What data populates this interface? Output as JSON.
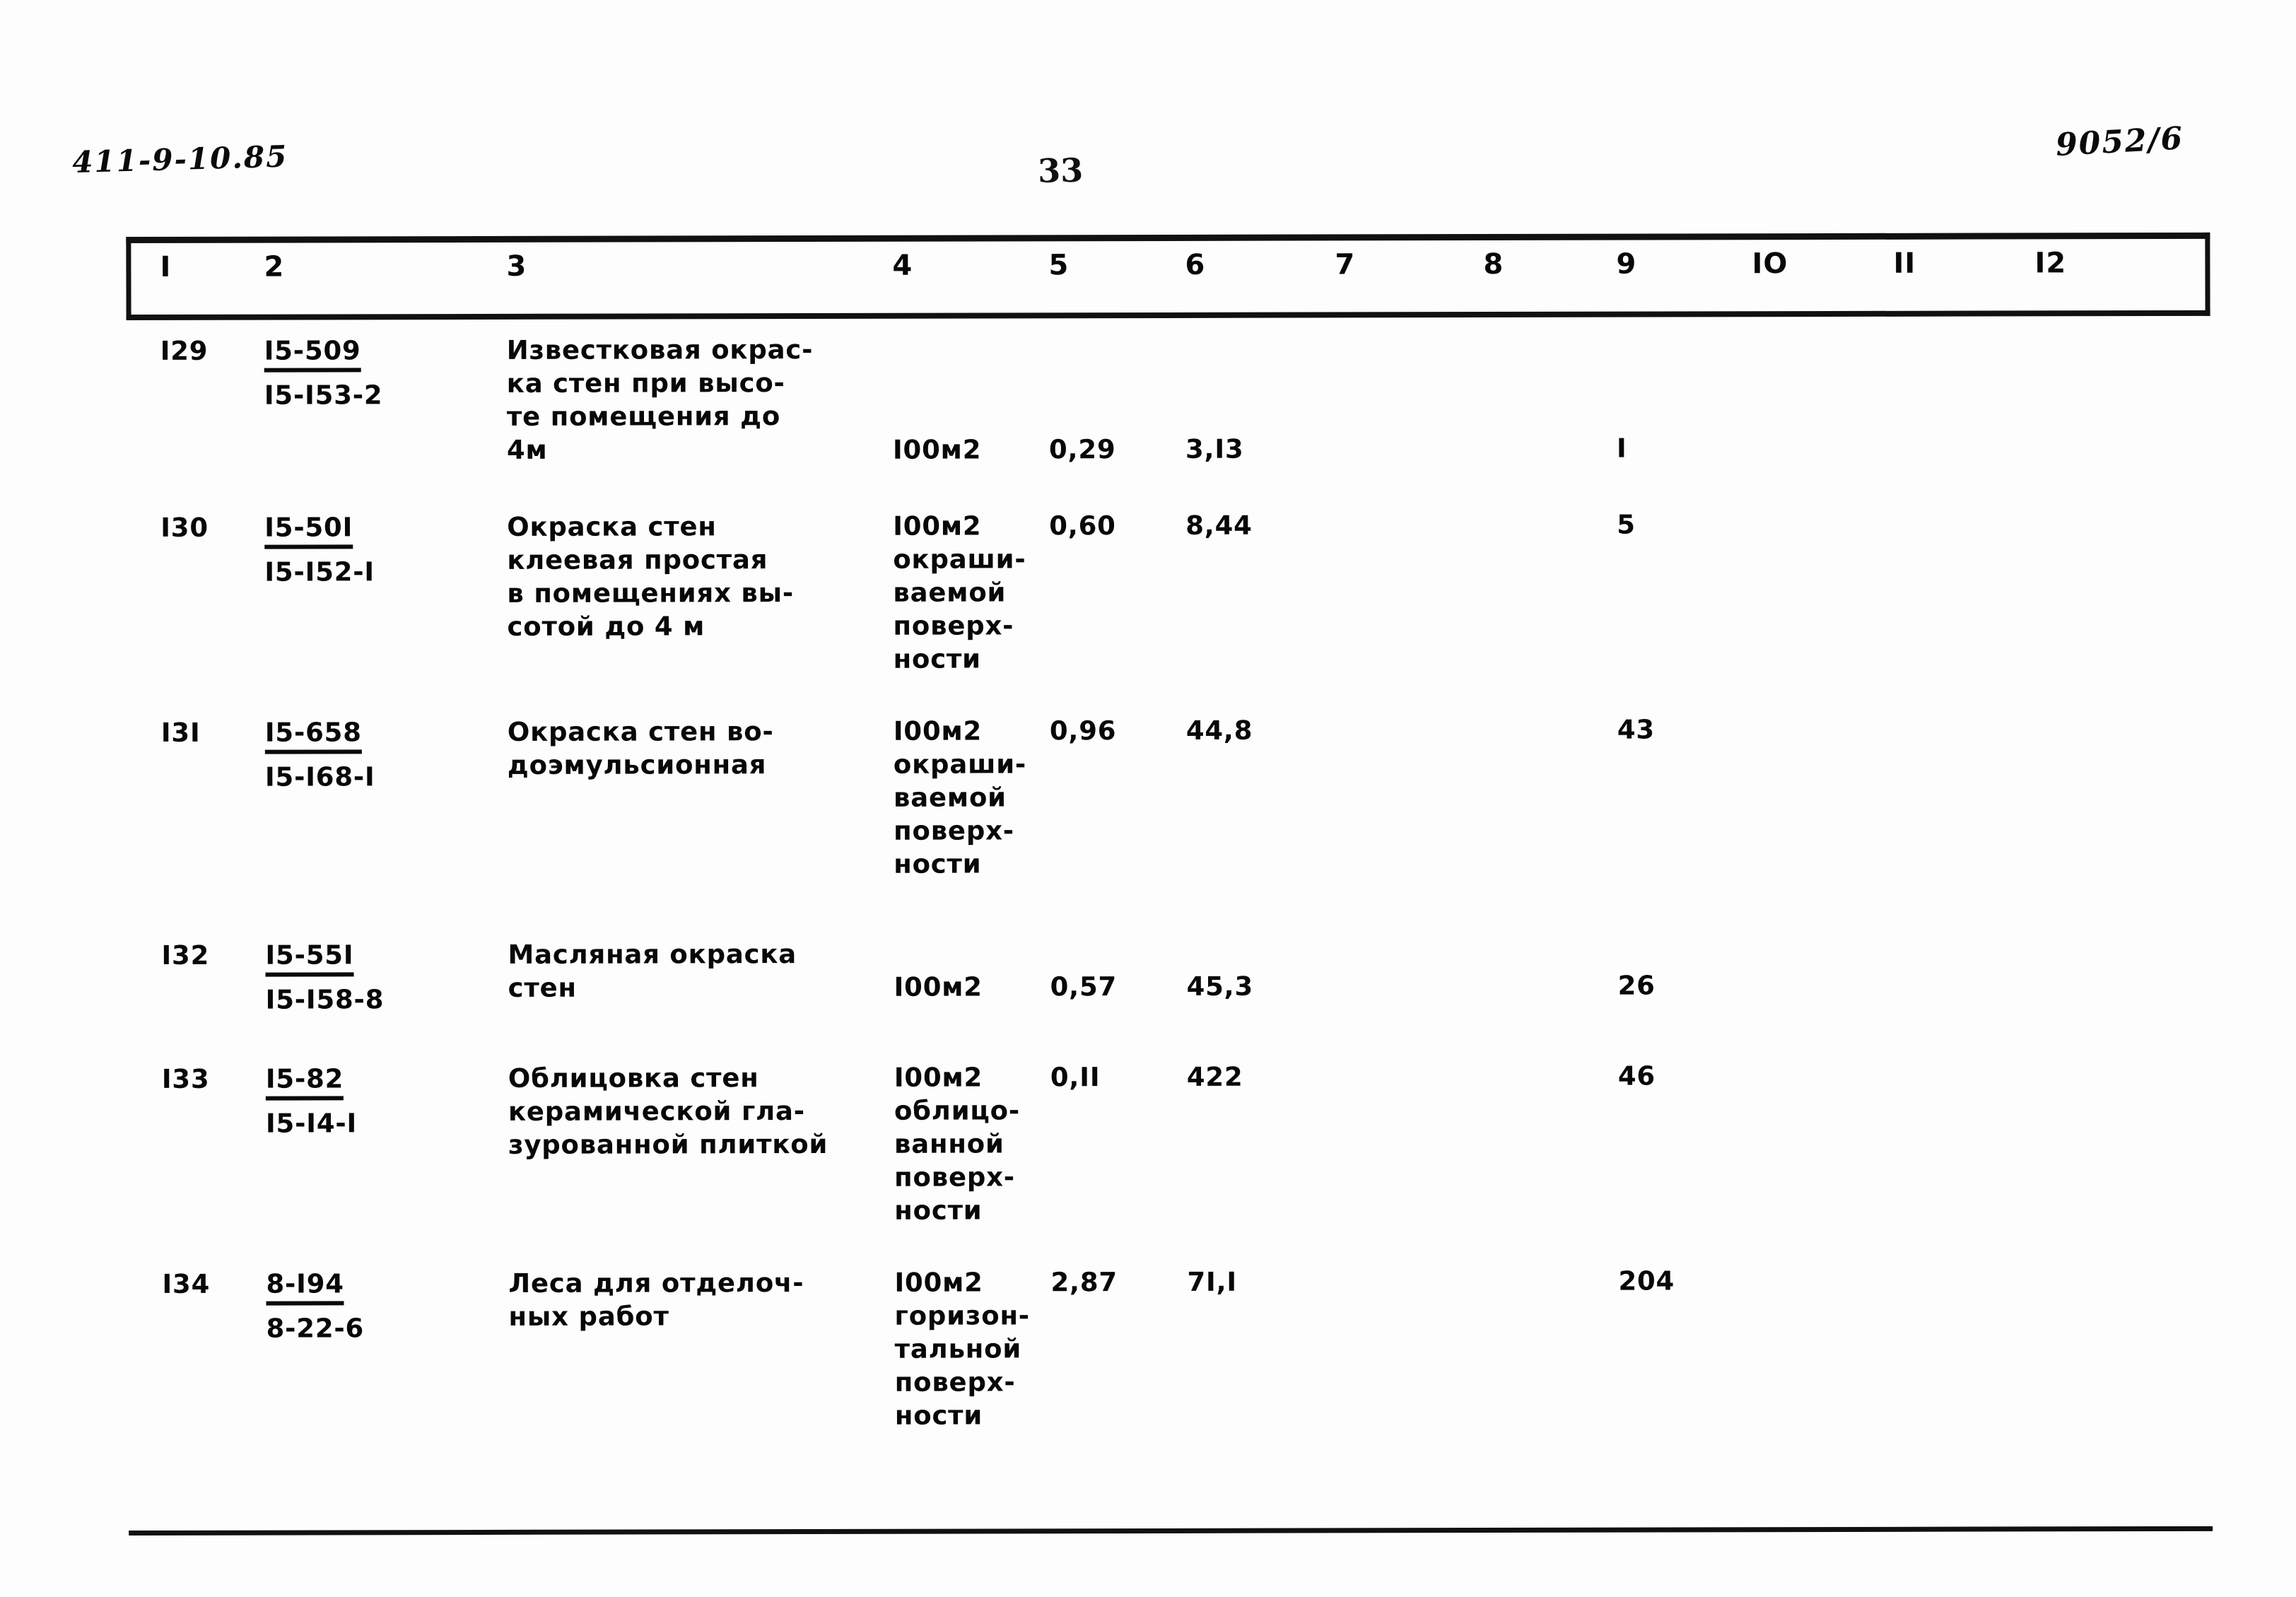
{
  "document": {
    "doc_code_handwritten": "411-9-10.85",
    "sheet_code_handwritten": "9052/6",
    "page_number": "33"
  },
  "table": {
    "column_headers": [
      "I",
      "2",
      "3",
      "4",
      "5",
      "6",
      "7",
      "8",
      "9",
      "IO",
      "II",
      "I2"
    ],
    "rows": [
      {
        "num": "I29",
        "code_top": "I5-509",
        "code_bottom": "I5-I53-2",
        "description": "Известковая окрас-\nка стен при высо-\nте помещения до\n4м",
        "unit_main": "I00м2",
        "unit_sub": "",
        "qty": "0,29",
        "price": "3,I3",
        "col7": "",
        "col8": "",
        "total": "I",
        "col10": "",
        "col11": "",
        "col12": ""
      },
      {
        "num": "I30",
        "code_top": "I5-50I",
        "code_bottom": "I5-I52-I",
        "description": "Окраска стен\nклеевая простая\nв помещениях вы-\nсотой до 4 м",
        "unit_main": "I00м2",
        "unit_sub": "окраши-\nваемой\nповерх-\nности",
        "qty": "0,60",
        "price": "8,44",
        "col7": "",
        "col8": "",
        "total": "5",
        "col10": "",
        "col11": "",
        "col12": ""
      },
      {
        "num": "I3I",
        "code_top": "I5-658",
        "code_bottom": "I5-I68-I",
        "description": "Окраска стен во-\nдоэмульсионная",
        "unit_main": "I00м2",
        "unit_sub": "окраши-\nваемой\nповерх-\nности",
        "qty": "0,96",
        "price": "44,8",
        "col7": "",
        "col8": "",
        "total": "43",
        "col10": "",
        "col11": "",
        "col12": ""
      },
      {
        "num": "I32",
        "code_top": "I5-55I",
        "code_bottom": "I5-I58-8",
        "description": "Масляная окраска\nстен",
        "unit_main": "I00м2",
        "unit_sub": "",
        "qty": "0,57",
        "price": "45,3",
        "col7": "",
        "col8": "",
        "total": "26",
        "col10": "",
        "col11": "",
        "col12": ""
      },
      {
        "num": "I33",
        "code_top": "I5-82",
        "code_bottom": "I5-I4-I",
        "description": "Облицовка стен\nкерамической гла-\nзурованной плиткой",
        "unit_main": "I00м2",
        "unit_sub": "облицо-\nванной\nповерх-\nности",
        "qty": "0,II",
        "price": "422",
        "col7": "",
        "col8": "",
        "total": "46",
        "col10": "",
        "col11": "",
        "col12": ""
      },
      {
        "num": "I34",
        "code_top": "8-I94",
        "code_bottom": "8-22-6",
        "description": "Леса для отделоч-\nных работ",
        "unit_main": "I00м2",
        "unit_sub": "горизон-\nтальной\nповерх-\nности",
        "qty": "2,87",
        "price": "7I,I",
        "col7": "",
        "col8": "",
        "total": "204",
        "col10": "",
        "col11": "",
        "col12": ""
      }
    ]
  },
  "colors": {
    "ink": "#080808",
    "paper": "#fdfdfd"
  }
}
